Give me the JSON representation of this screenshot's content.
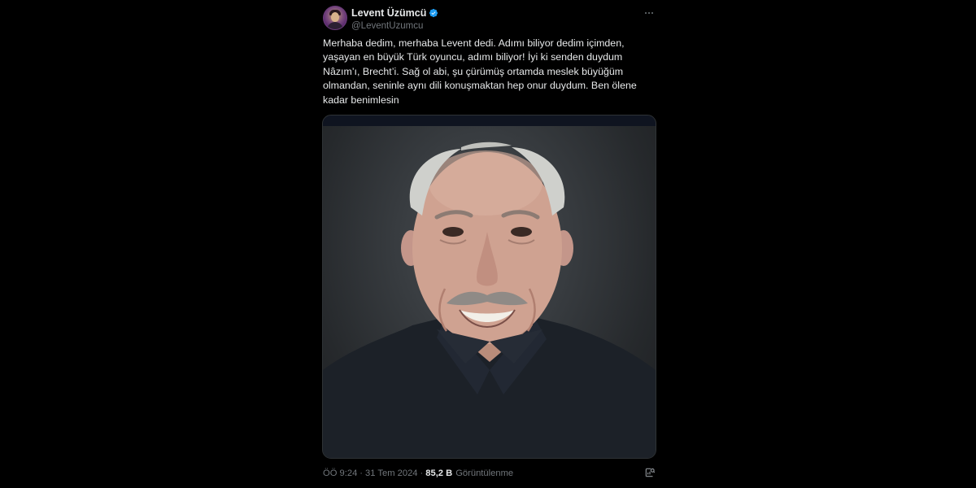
{
  "author": {
    "display_name": "Levent Üzümcü",
    "handle": "@LeventUzumcu",
    "verified": true
  },
  "tweet": {
    "text_lines": [
      "Merhaba dedim, merhaba Levent dedi. Adımı biliyor dedim içimden,",
      "yaşayan en büyük Türk oyuncu, adımı biliyor! İyi ki senden duydum",
      "Nâzım’ı, Brecht’i. Sağ ol abi, şu çürümüş ortamda meslek büyüğüm",
      "olmandan, seninle aynı dili konuşmaktan hep onur duydum. Ben ölene",
      "kadar benimlesin"
    ]
  },
  "meta": {
    "time": "ÖÖ 9:24",
    "separator": "·",
    "date": "31 Tem 2024",
    "views_count": "85,2 B",
    "views_label": "Görüntülenme"
  },
  "icons": {
    "verified": "verified-badge-icon",
    "more": "more-options-icon",
    "analytics": "analytics-icon"
  },
  "colors": {
    "background": "#000000",
    "text": "#e7e9ea",
    "secondary": "#71767b",
    "verified_blue": "#1d9bf0"
  }
}
